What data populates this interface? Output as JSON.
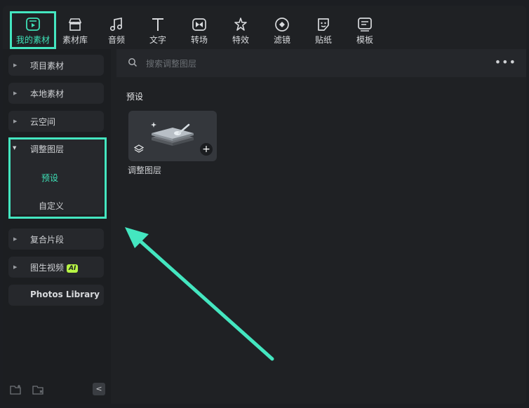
{
  "toolbar": {
    "items": [
      {
        "label": "我的素材",
        "icon": "my-media-icon"
      },
      {
        "label": "素材库",
        "icon": "stock-media-icon"
      },
      {
        "label": "音频",
        "icon": "audio-icon"
      },
      {
        "label": "文字",
        "icon": "text-icon"
      },
      {
        "label": "转场",
        "icon": "transition-icon"
      },
      {
        "label": "特效",
        "icon": "effects-icon"
      },
      {
        "label": "滤镜",
        "icon": "filter-icon"
      },
      {
        "label": "贴纸",
        "icon": "sticker-icon"
      },
      {
        "label": "模板",
        "icon": "template-icon"
      }
    ],
    "active_index": 0
  },
  "sidebar": {
    "items": [
      {
        "label": "项目素材"
      },
      {
        "label": "本地素材"
      },
      {
        "label": "云空间"
      }
    ],
    "group": {
      "label": "调整图层",
      "children": [
        {
          "label": "预设",
          "selected": true
        },
        {
          "label": "自定义",
          "selected": false
        }
      ]
    },
    "items_after": [
      {
        "label": "复合片段"
      },
      {
        "label": "图生视频",
        "badge": "AI"
      },
      {
        "label": "Photos Library"
      }
    ],
    "footer": {
      "collapse_glyph": "<"
    }
  },
  "main": {
    "search": {
      "placeholder": "搜索调整图层"
    },
    "more_glyph": "•••",
    "section_title": "预设",
    "cards": [
      {
        "label": "调整图层",
        "add_glyph": "+"
      }
    ]
  },
  "colors": {
    "accent": "#3ee1b7",
    "highlight_box": "#44e6c0",
    "ai_badge": "#b7f545",
    "background": "#1f2124"
  }
}
